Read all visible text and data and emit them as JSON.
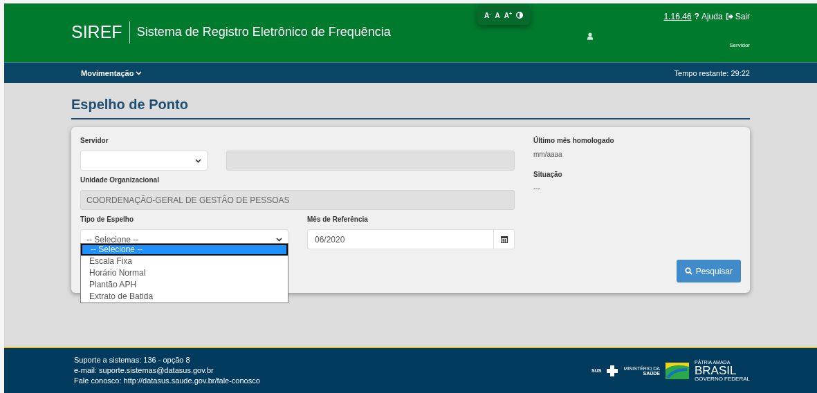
{
  "header": {
    "logo": "SIREF",
    "title": "Sistema de Registro Eletrônico de Frequência",
    "font_controls": [
      "A$^{-}$",
      "A",
      "A$^{+}$"
    ],
    "version": "1.16.46",
    "help_icon": "?",
    "help": "Ajuda",
    "exit": "Sair",
    "role": "Servidor"
  },
  "nav": {
    "menu": "Movimentação",
    "timer": "Tempo restante: 29:22"
  },
  "page_title": "Espelho de Ponto",
  "form": {
    "servidor": {
      "label": "Servidor"
    },
    "unidade": {
      "label": "Unidade Organizacional",
      "value": "COORDENAÇÃO-GERAL DE GESTÃO DE PESSOAS"
    },
    "tipo": {
      "label": "Tipo de Espelho",
      "value": "-- Selecione --",
      "expanded": true,
      "options": [
        {
          "label": "-- Selecione --",
          "selected": true
        },
        {
          "label": "Escala Fixa",
          "selected": false
        },
        {
          "label": "Horário Normal",
          "selected": false
        },
        {
          "label": "Plantão APH",
          "selected": false
        },
        {
          "label": "Extrato de Batida",
          "selected": false
        }
      ]
    },
    "mes": {
      "label": "Mês de Referência",
      "value": "06/2020"
    },
    "ultimo": {
      "label": "Último mês homologado",
      "value": "mm/aaaa"
    },
    "situacao": {
      "label": "Situação",
      "value": "---"
    },
    "search_button": "Pesquisar"
  },
  "footer": {
    "lines": [
      "Suporte a sistemas: 136 - opção 8",
      "e-mail: suporte.sistemas@datasus.gov.br",
      "Fale conosco: http://datasus.saude.gov.br/fale-conosco"
    ],
    "sus": "SUS",
    "ministerio": [
      "MINISTÉRIO DA",
      "SAÚDE"
    ],
    "brasil": [
      "PÁTRIA AMADA",
      "BRASIL",
      "GOVERNO FEDERAL"
    ]
  }
}
